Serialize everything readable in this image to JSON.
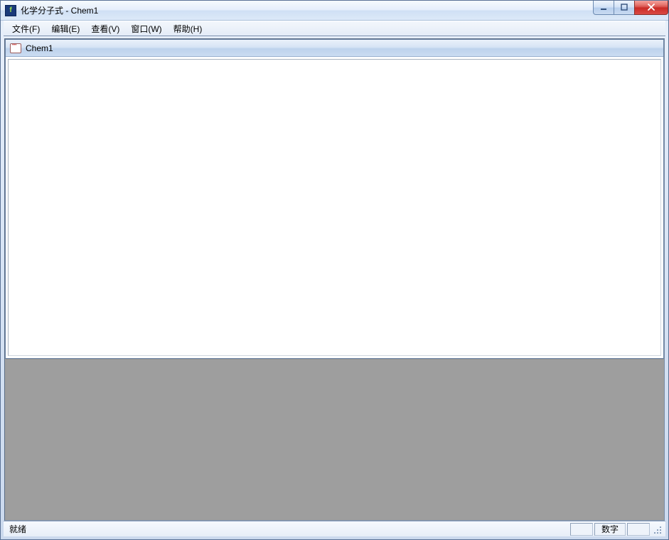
{
  "window": {
    "title": "化学分子式 - Chem1"
  },
  "menu": {
    "items": [
      {
        "label": "文件(F)"
      },
      {
        "label": "编辑(E)"
      },
      {
        "label": "查看(V)"
      },
      {
        "label": "窗口(W)"
      },
      {
        "label": "帮助(H)"
      }
    ]
  },
  "child": {
    "title": "Chem1"
  },
  "status": {
    "ready": "就绪",
    "numlock": "数字"
  }
}
